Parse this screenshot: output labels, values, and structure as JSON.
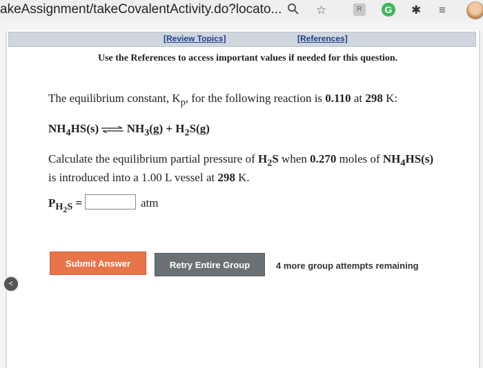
{
  "browser": {
    "url": "akeAssignment/takeCovalentActivity.do?locato...",
    "ext_letter": "R",
    "g_letter": "G"
  },
  "nav": {
    "review_topics": "[Review Topics]",
    "references": "[References]"
  },
  "notice": "Use the References to access important values if needed for this question.",
  "question": {
    "line1_prefix": "The equilibrium constant, K",
    "line1_sub": "p",
    "line1_mid": ", for the following reaction is ",
    "k_value": "0.110",
    "line1_at": " at ",
    "temp": "298",
    "line1_end": " K:",
    "reaction_left": "NH",
    "reaction_left_sub": "4",
    "reaction_left_rest": "HS(s)",
    "reaction_right": "NH",
    "reaction_right_sub": "3",
    "reaction_right_rest": "(g) + H",
    "reaction_right_sub2": "2",
    "reaction_right_end": "S(g)",
    "calc_a": "Calculate the equilibrium partial pressure of ",
    "calc_h": "H",
    "calc_sub": "2",
    "calc_s": "S",
    "calc_b": " when ",
    "moles": "0.270",
    "calc_c": " moles of ",
    "calc_nh": "NH",
    "calc_sub4": "4",
    "calc_hs": "HS(s)",
    "line3": "is introduced into a ",
    "volume": "1.00",
    "line3b": " L vessel at ",
    "temp2": "298",
    "line3c": " K."
  },
  "answer": {
    "label_p": "P",
    "label_sub": "H",
    "label_sub2": "2",
    "label_s": "S",
    "eq": " =",
    "value": "",
    "unit": "atm"
  },
  "buttons": {
    "submit": "Submit Answer",
    "retry": "Retry Entire Group"
  },
  "attempts_text": "4 more group attempts remaining"
}
